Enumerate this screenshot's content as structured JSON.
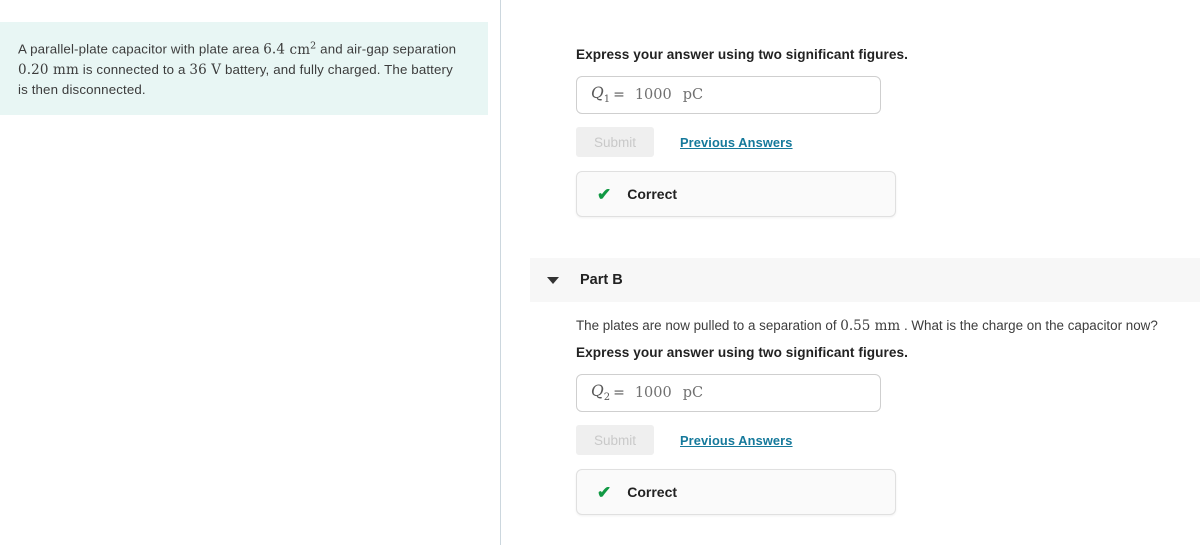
{
  "problem": {
    "text_parts": {
      "s1": "A parallel-plate capacitor with plate area ",
      "area_value": "6.4",
      "area_unit": "cm",
      "area_exp": "2",
      "s2": " and air-gap separation ",
      "gap_value": "0.20",
      "gap_unit": "mm",
      "s3": " is connected to a ",
      "voltage_value": "36",
      "voltage_unit": "V",
      "s4": " battery, and fully charged. The battery is then disconnected."
    }
  },
  "colors": {
    "problem_background": "#e8f6f4",
    "link": "#15799b",
    "correct_check": "#119944",
    "part_header_background": "#f7f7f7",
    "divider": "#ccd7de"
  },
  "part_a": {
    "instruction": "Express your answer using two significant figures.",
    "answer": {
      "symbol": "Q",
      "subscript": "1",
      "equals": "=",
      "value": "1000",
      "unit": "pC",
      "placeholder": ""
    },
    "submit_label": "Submit",
    "previous_answers_label": "Previous Answers",
    "feedback": {
      "icon": "check-icon",
      "label": "Correct"
    }
  },
  "part_b": {
    "header": {
      "caret_icon": "chevron-down-icon",
      "title": "Part B"
    },
    "question": {
      "s1": "The plates are now pulled to a separation of ",
      "sep_value": "0.55",
      "sep_unit": "mm",
      "s2": " . What is the charge on the capacitor now?"
    },
    "instruction": "Express your answer using two significant figures.",
    "answer": {
      "symbol": "Q",
      "subscript": "2",
      "equals": "=",
      "value": "1000",
      "unit": "pC",
      "placeholder": ""
    },
    "submit_label": "Submit",
    "previous_answers_label": "Previous Answers",
    "feedback": {
      "icon": "check-icon",
      "label": "Correct"
    }
  }
}
